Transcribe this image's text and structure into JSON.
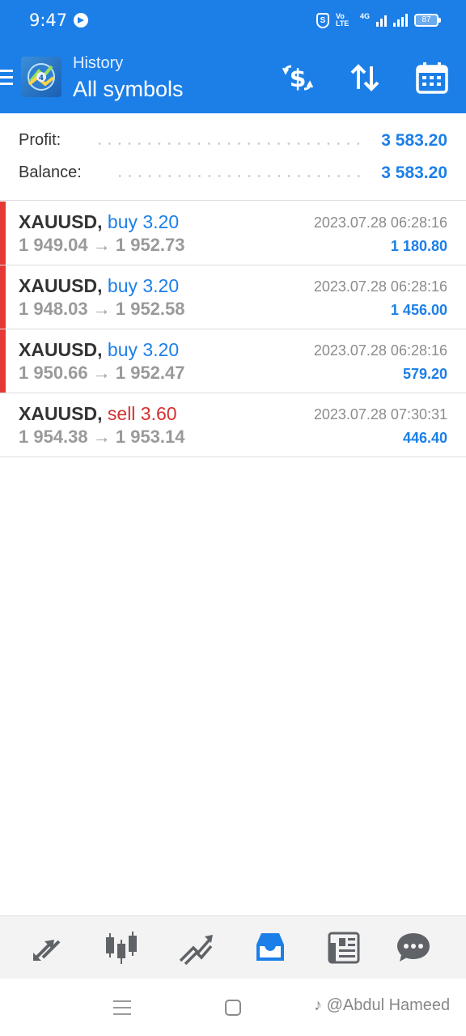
{
  "status_bar": {
    "time": "9:47",
    "network": "4G",
    "battery": "87"
  },
  "header": {
    "subtitle": "History",
    "title": "All symbols",
    "icons": [
      "menu-icon",
      "metatrader-logo",
      "dollar-exchange-icon",
      "sort-icon",
      "calendar-icon"
    ]
  },
  "summary": {
    "profit_label": "Profit:",
    "profit_value": "3 583.20",
    "balance_label": "Balance:",
    "balance_value": "3 583.20"
  },
  "deals": [
    {
      "symbol": "XAUUSD,",
      "side": "buy 3.20",
      "prices": "1 949.04 → 1 952.73",
      "time": "2023.07.28 06:28:16",
      "profit": "1 180.80",
      "marked": true
    },
    {
      "symbol": "XAUUSD,",
      "side": "buy 3.20",
      "prices": "1 948.03 → 1 952.58",
      "time": "2023.07.28 06:28:16",
      "profit": "1 456.00",
      "marked": true
    },
    {
      "symbol": "XAUUSD,",
      "side": "buy 3.20",
      "prices": "1 950.66 → 1 952.47",
      "time": "2023.07.28 06:28:16",
      "profit": "579.20",
      "marked": true
    },
    {
      "symbol": "XAUUSD,",
      "side": "sell 3.60",
      "prices": "1 954.38 → 1 953.14",
      "time": "2023.07.28 07:30:31",
      "profit": "446.40",
      "marked": false
    }
  ],
  "tabs": [
    "quotes-icon",
    "chart-icon",
    "trade-icon",
    "history-icon",
    "news-icon",
    "chat-icon"
  ],
  "active_tab": "history-icon",
  "colors": {
    "accent": "#1c7fe8",
    "buy": "#1c7fe8",
    "sell": "#d62f2f",
    "marker": "#e53935"
  },
  "watermark": "@Abdul Hameed"
}
